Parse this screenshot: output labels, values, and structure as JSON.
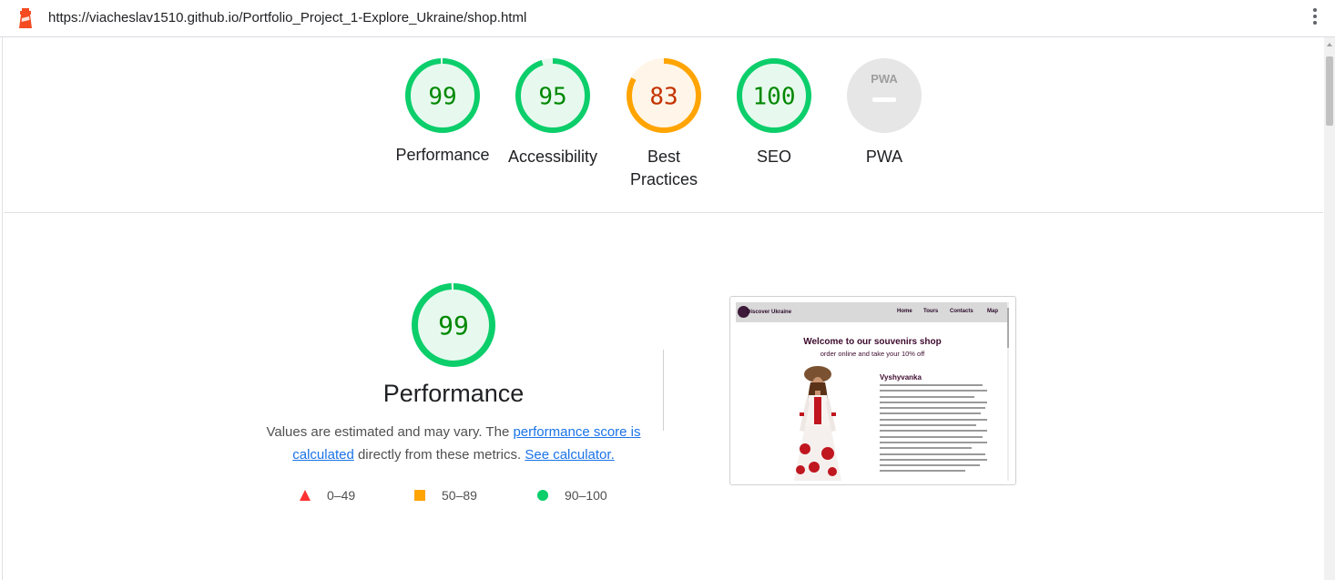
{
  "browser": {
    "url": "https://viacheslav1510.github.io/Portfolio_Project_1-Explore_Ukraine/shop.html"
  },
  "summary_gauges": [
    {
      "label": "Performance",
      "score": "99",
      "value": 99,
      "color": "#0cce6b",
      "text_color": "#008800",
      "bg": "#e7f9ee"
    },
    {
      "label": "Accessibility",
      "score": "95",
      "value": 95,
      "color": "#0cce6b",
      "text_color": "#008800",
      "bg": "#e7f9ee"
    },
    {
      "label": "Best Practices",
      "score": "83",
      "value": 83,
      "color": "#ffa400",
      "text_color": "#c33300",
      "bg": "#fff5e8"
    },
    {
      "label": "SEO",
      "score": "100",
      "value": 100,
      "color": "#0cce6b",
      "text_color": "#008800",
      "bg": "#e7f9ee"
    },
    {
      "label": "PWA",
      "score": "PWA",
      "value": null,
      "color": "#cccccc",
      "text_color": "#9e9e9e",
      "bg": "#e6e6e6"
    }
  ],
  "category": {
    "score": "99",
    "value": 99,
    "title": "Performance",
    "desc_prefix": "Values are estimated and may vary. The ",
    "link_score": "performance score is calculated",
    "desc_mid": " directly from these metrics. ",
    "link_calc": "See calculator."
  },
  "legend": [
    {
      "range": "0–49",
      "shape": "triangle",
      "color": "#ff3333"
    },
    {
      "range": "50–89",
      "shape": "square",
      "color": "#ffa400"
    },
    {
      "range": "90–100",
      "shape": "circle",
      "color": "#0cce6b"
    }
  ],
  "final_screenshot": {
    "brand": "Discover Ukraine",
    "nav": [
      "Home",
      "Tours",
      "Contacts",
      "Map"
    ],
    "heading": "Welcome to our souvenirs shop",
    "subheading": "order online and take your 10% off",
    "product_title": "Vyshyvanka"
  }
}
